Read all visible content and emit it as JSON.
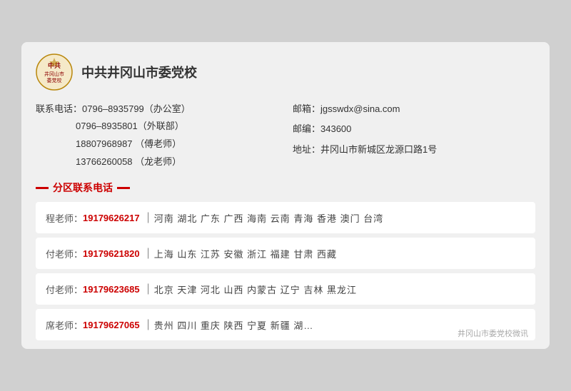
{
  "header": {
    "org_name": "中共井冈山市委党校"
  },
  "contact": {
    "phone_label": "联系电话：",
    "phones": [
      {
        "number": "0796–8935799",
        "note": "（办公室）"
      },
      {
        "number": "0796–8935801",
        "note": "（外联部）"
      },
      {
        "number": "18807968987",
        "note": "（傅老师）"
      },
      {
        "number": "13766260058",
        "note": "（龙老师）"
      }
    ],
    "email_label": "邮箱：",
    "email": "jgsswdx@sina.com",
    "zip_label": "邮编：",
    "zip": "343600",
    "address_label": "地址：",
    "address": "井冈山市新城区龙源口路1号"
  },
  "section_title": "分区联系电话",
  "regions": [
    {
      "teacher": "程老师：",
      "phone": "19179626217",
      "areas": "河南  湖北  广东  广西  海南  云南  青海  香港  澳门  台湾"
    },
    {
      "teacher": "付老师：",
      "phone": "19179621820",
      "areas": "上海  山东  江苏  安徽  浙江  福建  甘肃  西藏"
    },
    {
      "teacher": "付老师：",
      "phone": "19179623685",
      "areas": "北京  天津  河北  山西  内蒙古  辽宁  吉林  黑龙江"
    },
    {
      "teacher": "席老师：",
      "phone": "19179627065",
      "areas": "贵州  四川  重庆  陕西  宁夏  新疆  湖…"
    }
  ],
  "watermark": "井冈山市委党校微讯"
}
